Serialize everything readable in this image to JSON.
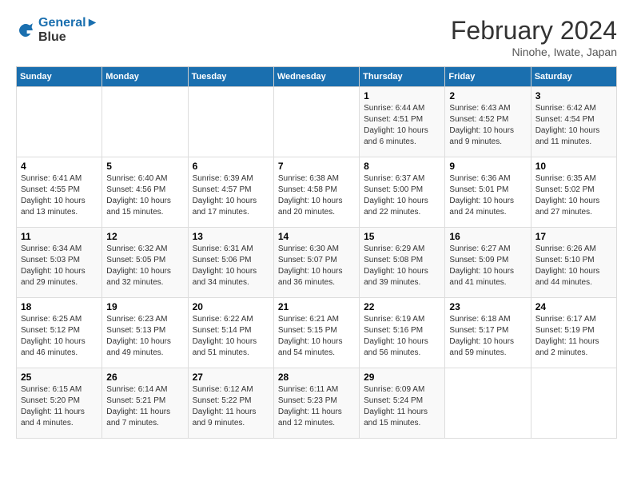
{
  "header": {
    "logo_line1": "General",
    "logo_line2": "Blue",
    "month_title": "February 2024",
    "subtitle": "Ninohe, Iwate, Japan"
  },
  "weekdays": [
    "Sunday",
    "Monday",
    "Tuesday",
    "Wednesday",
    "Thursday",
    "Friday",
    "Saturday"
  ],
  "weeks": [
    [
      {
        "day": "",
        "info": ""
      },
      {
        "day": "",
        "info": ""
      },
      {
        "day": "",
        "info": ""
      },
      {
        "day": "",
        "info": ""
      },
      {
        "day": "1",
        "info": "Sunrise: 6:44 AM\nSunset: 4:51 PM\nDaylight: 10 hours\nand 6 minutes."
      },
      {
        "day": "2",
        "info": "Sunrise: 6:43 AM\nSunset: 4:52 PM\nDaylight: 10 hours\nand 9 minutes."
      },
      {
        "day": "3",
        "info": "Sunrise: 6:42 AM\nSunset: 4:54 PM\nDaylight: 10 hours\nand 11 minutes."
      }
    ],
    [
      {
        "day": "4",
        "info": "Sunrise: 6:41 AM\nSunset: 4:55 PM\nDaylight: 10 hours\nand 13 minutes."
      },
      {
        "day": "5",
        "info": "Sunrise: 6:40 AM\nSunset: 4:56 PM\nDaylight: 10 hours\nand 15 minutes."
      },
      {
        "day": "6",
        "info": "Sunrise: 6:39 AM\nSunset: 4:57 PM\nDaylight: 10 hours\nand 17 minutes."
      },
      {
        "day": "7",
        "info": "Sunrise: 6:38 AM\nSunset: 4:58 PM\nDaylight: 10 hours\nand 20 minutes."
      },
      {
        "day": "8",
        "info": "Sunrise: 6:37 AM\nSunset: 5:00 PM\nDaylight: 10 hours\nand 22 minutes."
      },
      {
        "day": "9",
        "info": "Sunrise: 6:36 AM\nSunset: 5:01 PM\nDaylight: 10 hours\nand 24 minutes."
      },
      {
        "day": "10",
        "info": "Sunrise: 6:35 AM\nSunset: 5:02 PM\nDaylight: 10 hours\nand 27 minutes."
      }
    ],
    [
      {
        "day": "11",
        "info": "Sunrise: 6:34 AM\nSunset: 5:03 PM\nDaylight: 10 hours\nand 29 minutes."
      },
      {
        "day": "12",
        "info": "Sunrise: 6:32 AM\nSunset: 5:05 PM\nDaylight: 10 hours\nand 32 minutes."
      },
      {
        "day": "13",
        "info": "Sunrise: 6:31 AM\nSunset: 5:06 PM\nDaylight: 10 hours\nand 34 minutes."
      },
      {
        "day": "14",
        "info": "Sunrise: 6:30 AM\nSunset: 5:07 PM\nDaylight: 10 hours\nand 36 minutes."
      },
      {
        "day": "15",
        "info": "Sunrise: 6:29 AM\nSunset: 5:08 PM\nDaylight: 10 hours\nand 39 minutes."
      },
      {
        "day": "16",
        "info": "Sunrise: 6:27 AM\nSunset: 5:09 PM\nDaylight: 10 hours\nand 41 minutes."
      },
      {
        "day": "17",
        "info": "Sunrise: 6:26 AM\nSunset: 5:10 PM\nDaylight: 10 hours\nand 44 minutes."
      }
    ],
    [
      {
        "day": "18",
        "info": "Sunrise: 6:25 AM\nSunset: 5:12 PM\nDaylight: 10 hours\nand 46 minutes."
      },
      {
        "day": "19",
        "info": "Sunrise: 6:23 AM\nSunset: 5:13 PM\nDaylight: 10 hours\nand 49 minutes."
      },
      {
        "day": "20",
        "info": "Sunrise: 6:22 AM\nSunset: 5:14 PM\nDaylight: 10 hours\nand 51 minutes."
      },
      {
        "day": "21",
        "info": "Sunrise: 6:21 AM\nSunset: 5:15 PM\nDaylight: 10 hours\nand 54 minutes."
      },
      {
        "day": "22",
        "info": "Sunrise: 6:19 AM\nSunset: 5:16 PM\nDaylight: 10 hours\nand 56 minutes."
      },
      {
        "day": "23",
        "info": "Sunrise: 6:18 AM\nSunset: 5:17 PM\nDaylight: 10 hours\nand 59 minutes."
      },
      {
        "day": "24",
        "info": "Sunrise: 6:17 AM\nSunset: 5:19 PM\nDaylight: 11 hours\nand 2 minutes."
      }
    ],
    [
      {
        "day": "25",
        "info": "Sunrise: 6:15 AM\nSunset: 5:20 PM\nDaylight: 11 hours\nand 4 minutes."
      },
      {
        "day": "26",
        "info": "Sunrise: 6:14 AM\nSunset: 5:21 PM\nDaylight: 11 hours\nand 7 minutes."
      },
      {
        "day": "27",
        "info": "Sunrise: 6:12 AM\nSunset: 5:22 PM\nDaylight: 11 hours\nand 9 minutes."
      },
      {
        "day": "28",
        "info": "Sunrise: 6:11 AM\nSunset: 5:23 PM\nDaylight: 11 hours\nand 12 minutes."
      },
      {
        "day": "29",
        "info": "Sunrise: 6:09 AM\nSunset: 5:24 PM\nDaylight: 11 hours\nand 15 minutes."
      },
      {
        "day": "",
        "info": ""
      },
      {
        "day": "",
        "info": ""
      }
    ]
  ]
}
